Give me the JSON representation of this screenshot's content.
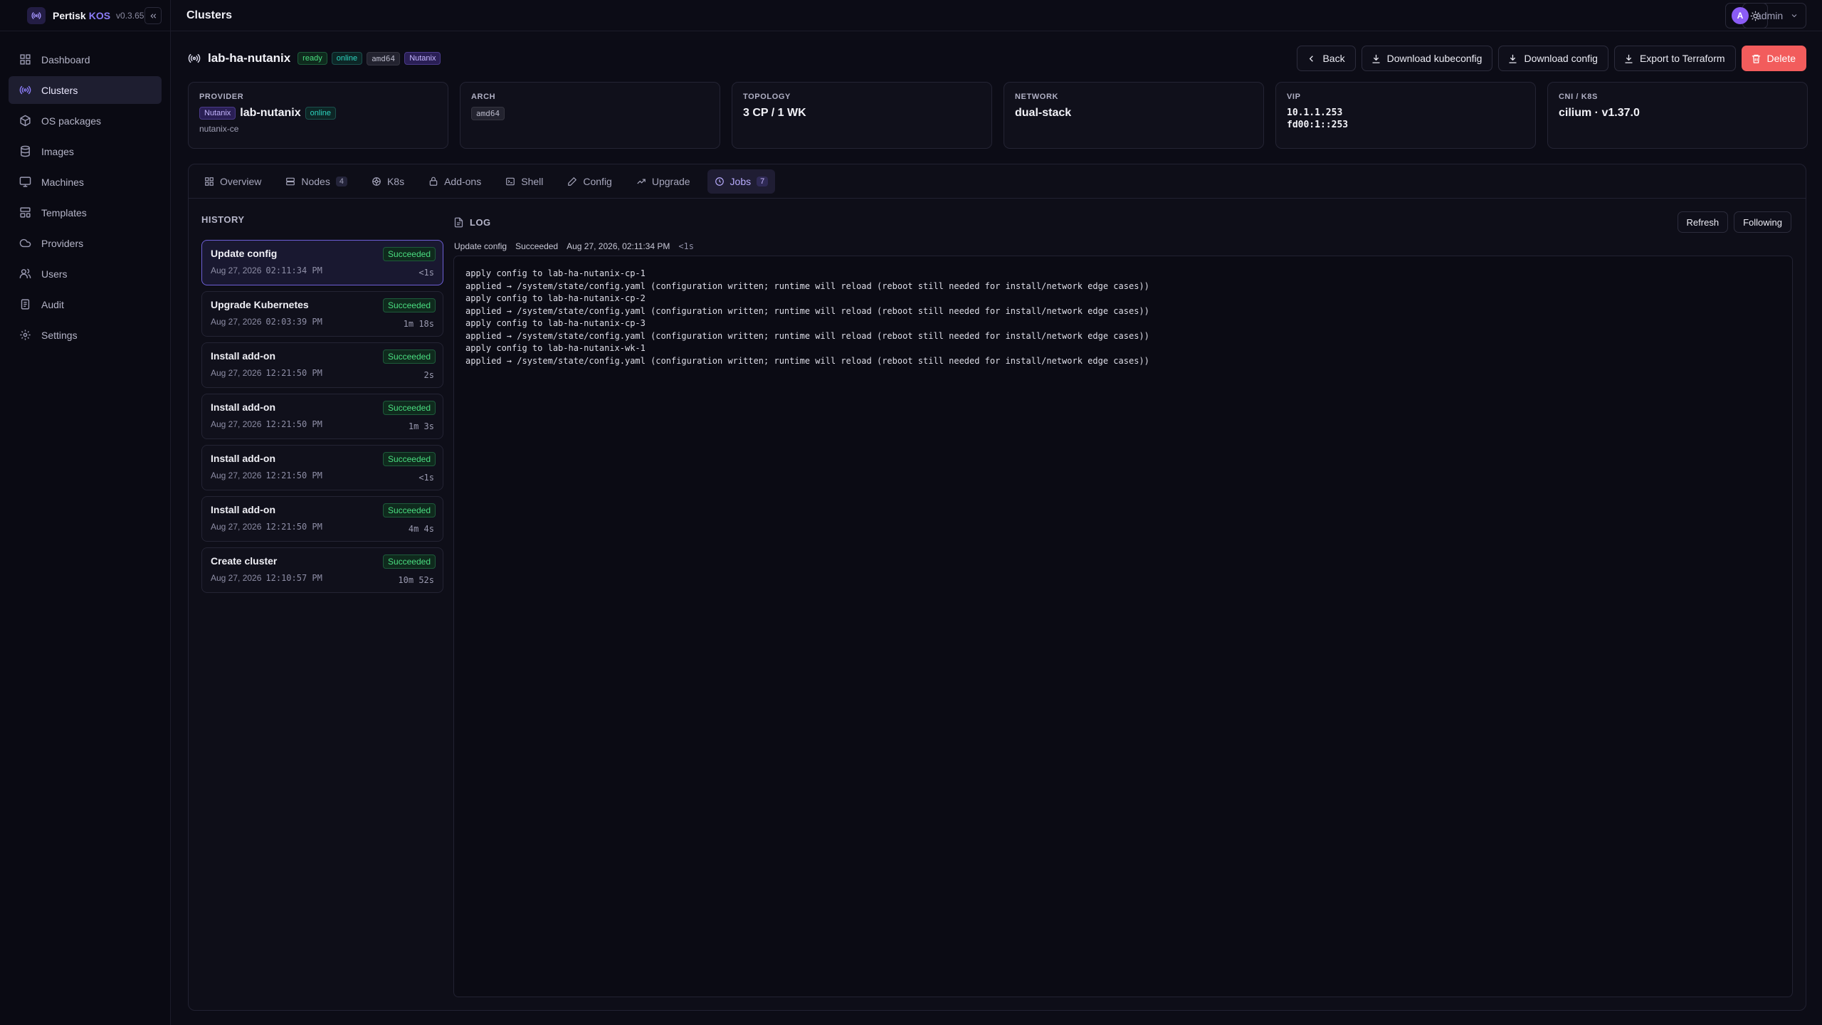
{
  "brand": {
    "name": "Pertisk",
    "product": "KOS",
    "version": "v0.3.65"
  },
  "sidebar": {
    "items": [
      {
        "label": "Dashboard",
        "icon": "dashboard-icon",
        "active": false
      },
      {
        "label": "Clusters",
        "icon": "clusters-icon",
        "active": true
      },
      {
        "label": "OS packages",
        "icon": "package-icon",
        "active": false
      },
      {
        "label": "Images",
        "icon": "images-icon",
        "active": false
      },
      {
        "label": "Machines",
        "icon": "machines-icon",
        "active": false
      },
      {
        "label": "Templates",
        "icon": "templates-icon",
        "active": false
      },
      {
        "label": "Providers",
        "icon": "cloud-icon",
        "active": false
      },
      {
        "label": "Users",
        "icon": "users-icon",
        "active": false
      },
      {
        "label": "Audit",
        "icon": "audit-icon",
        "active": false
      },
      {
        "label": "Settings",
        "icon": "gear-icon",
        "active": false
      }
    ]
  },
  "topbar": {
    "title": "Clusters",
    "user": {
      "initial": "A",
      "name": "admin"
    }
  },
  "cluster": {
    "name": "lab-ha-nutanix",
    "badges": [
      "ready",
      "online",
      "amd64",
      "Nutanix"
    ]
  },
  "actions": {
    "back": "Back",
    "download_kubeconfig": "Download kubeconfig",
    "download_config": "Download config",
    "export_terraform": "Export to Terraform",
    "delete": "Delete"
  },
  "cards": {
    "provider": {
      "label": "PROVIDER",
      "badge": "Nutanix",
      "name": "lab-nutanix",
      "status": "online",
      "sub": "nutanix-ce"
    },
    "arch": {
      "label": "ARCH",
      "value": "amd64"
    },
    "topology": {
      "label": "TOPOLOGY",
      "value": "3 CP / 1 WK"
    },
    "network": {
      "label": "NETWORK",
      "value": "dual-stack"
    },
    "vip": {
      "label": "VIP",
      "v4": "10.1.1.253",
      "v6": "fd00:1::253"
    },
    "cni": {
      "label": "CNI / K8S",
      "value": "cilium · v1.37.0"
    }
  },
  "tabs": [
    {
      "label": "Overview",
      "icon": "overview-icon",
      "count": ""
    },
    {
      "label": "Nodes",
      "icon": "nodes-icon",
      "count": "4"
    },
    {
      "label": "K8s",
      "icon": "k8s-icon",
      "count": ""
    },
    {
      "label": "Add-ons",
      "icon": "addons-icon",
      "count": ""
    },
    {
      "label": "Shell",
      "icon": "shell-icon",
      "count": ""
    },
    {
      "label": "Config",
      "icon": "config-icon",
      "count": ""
    },
    {
      "label": "Upgrade",
      "icon": "upgrade-icon",
      "count": ""
    },
    {
      "label": "Jobs",
      "icon": "jobs-icon",
      "count": "7"
    }
  ],
  "history": {
    "title": "HISTORY",
    "jobs": [
      {
        "name": "Update config",
        "status": "Succeeded",
        "date": "Aug 27, 2026",
        "time": "02:11:34 PM",
        "duration": "<1s"
      },
      {
        "name": "Upgrade Kubernetes",
        "status": "Succeeded",
        "date": "Aug 27, 2026",
        "time": "02:03:39 PM",
        "duration": "1m 18s"
      },
      {
        "name": "Install add-on",
        "status": "Succeeded",
        "date": "Aug 27, 2026",
        "time": "12:21:50 PM",
        "duration": "2s"
      },
      {
        "name": "Install add-on",
        "status": "Succeeded",
        "date": "Aug 27, 2026",
        "time": "12:21:50 PM",
        "duration": "1m 3s"
      },
      {
        "name": "Install add-on",
        "status": "Succeeded",
        "date": "Aug 27, 2026",
        "time": "12:21:50 PM",
        "duration": "<1s"
      },
      {
        "name": "Install add-on",
        "status": "Succeeded",
        "date": "Aug 27, 2026",
        "time": "12:21:50 PM",
        "duration": "4m 4s"
      },
      {
        "name": "Create cluster",
        "status": "Succeeded",
        "date": "Aug 27, 2026",
        "time": "12:10:57 PM",
        "duration": "10m 52s"
      }
    ]
  },
  "log": {
    "title": "LOG",
    "refresh": "Refresh",
    "following": "Following",
    "meta": {
      "job": "Update config",
      "status": "Succeeded",
      "datetime": "Aug 27, 2026, 02:11:34 PM",
      "duration": "<1s"
    },
    "lines": [
      "apply config to lab-ha-nutanix-cp-1",
      "applied → /system/state/config.yaml (configuration written; runtime will reload (reboot still needed for install/network edge cases))",
      "apply config to lab-ha-nutanix-cp-2",
      "applied → /system/state/config.yaml (configuration written; runtime will reload (reboot still needed for install/network edge cases))",
      "apply config to lab-ha-nutanix-cp-3",
      "applied → /system/state/config.yaml (configuration written; runtime will reload (reboot still needed for install/network edge cases))",
      "apply config to lab-ha-nutanix-wk-1",
      "applied → /system/state/config.yaml (configuration written; runtime will reload (reboot still needed for install/network edge cases))"
    ]
  }
}
